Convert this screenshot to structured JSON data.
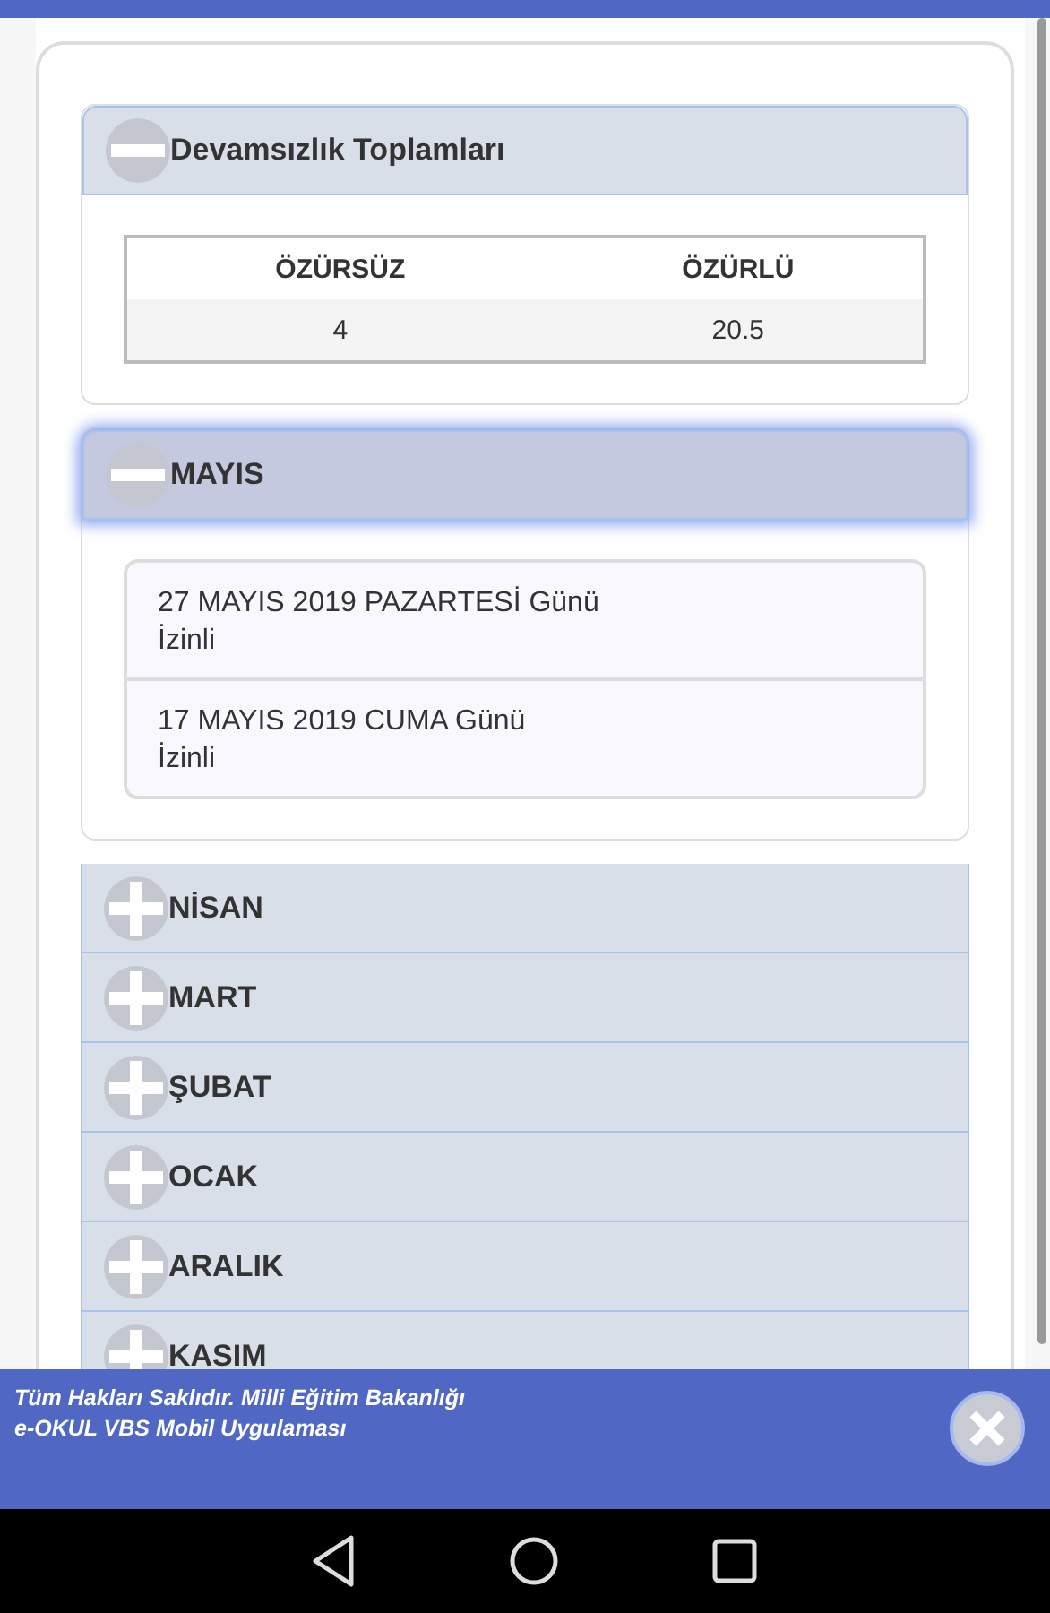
{
  "sections": [
    {
      "title": "Devamsızlık Toplamları",
      "expanded": true,
      "focused": false,
      "kind": "table",
      "table": {
        "columns": [
          "ÖZÜRSÜZ",
          "ÖZÜRLÜ"
        ],
        "rows": [
          [
            "4",
            "20.5"
          ]
        ]
      }
    },
    {
      "title": "MAYIS",
      "expanded": true,
      "focused": true,
      "kind": "list",
      "items": [
        {
          "date": "27 MAYIS 2019 PAZARTESİ Günü",
          "status": "İzinli"
        },
        {
          "date": "17 MAYIS 2019 CUMA Günü",
          "status": "İzinli"
        }
      ]
    },
    {
      "title": "NİSAN",
      "expanded": false,
      "focused": false
    },
    {
      "title": "MART",
      "expanded": false,
      "focused": false
    },
    {
      "title": "ŞUBAT",
      "expanded": false,
      "focused": false
    },
    {
      "title": "OCAK",
      "expanded": false,
      "focused": false
    },
    {
      "title": "ARALIK",
      "expanded": false,
      "focused": false
    },
    {
      "title": "KASIM",
      "expanded": false,
      "focused": false
    }
  ],
  "footer": {
    "lines": [
      "Tüm Hakları Saklıdır. Milli Eğitim Bakanlığı",
      "e-OKUL VBS Mobil Uygulaması"
    ]
  }
}
